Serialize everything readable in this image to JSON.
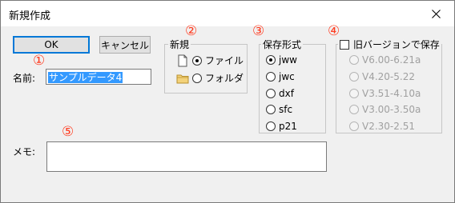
{
  "window": {
    "title": "新規作成",
    "close_icon": "close-icon"
  },
  "buttons": {
    "ok": "OK",
    "cancel": "キャンセル"
  },
  "annotations": {
    "n1": "①",
    "n2": "②",
    "n3": "③",
    "n4": "④",
    "n5": "⑤"
  },
  "name_field": {
    "label": "名前:",
    "value": "サンプルデータ4"
  },
  "new_group": {
    "label": "新規",
    "options": [
      {
        "label": "ファイル",
        "checked": true,
        "icon": "file-icon"
      },
      {
        "label": "フォルダ",
        "checked": false,
        "icon": "folder-icon"
      }
    ]
  },
  "format_group": {
    "label": "保存形式",
    "options": [
      {
        "label": "jww",
        "checked": true
      },
      {
        "label": "jwc",
        "checked": false
      },
      {
        "label": "dxf",
        "checked": false
      },
      {
        "label": "sfc",
        "checked": false
      },
      {
        "label": "p21",
        "checked": false
      }
    ]
  },
  "old_version_group": {
    "checkbox_label": "旧バージョンで保存",
    "checked": false,
    "options": [
      {
        "label": "V6.00-6.21a"
      },
      {
        "label": "V4.20-5.22"
      },
      {
        "label": "V3.51-4.10a"
      },
      {
        "label": "V3.00-3.50a"
      },
      {
        "label": "V2.30-2.51"
      }
    ]
  },
  "memo": {
    "label": "メモ:",
    "value": ""
  },
  "colors": {
    "annotation": "#ff3b1f",
    "selection": "#3399ff",
    "focus_border": "#0078d7"
  }
}
